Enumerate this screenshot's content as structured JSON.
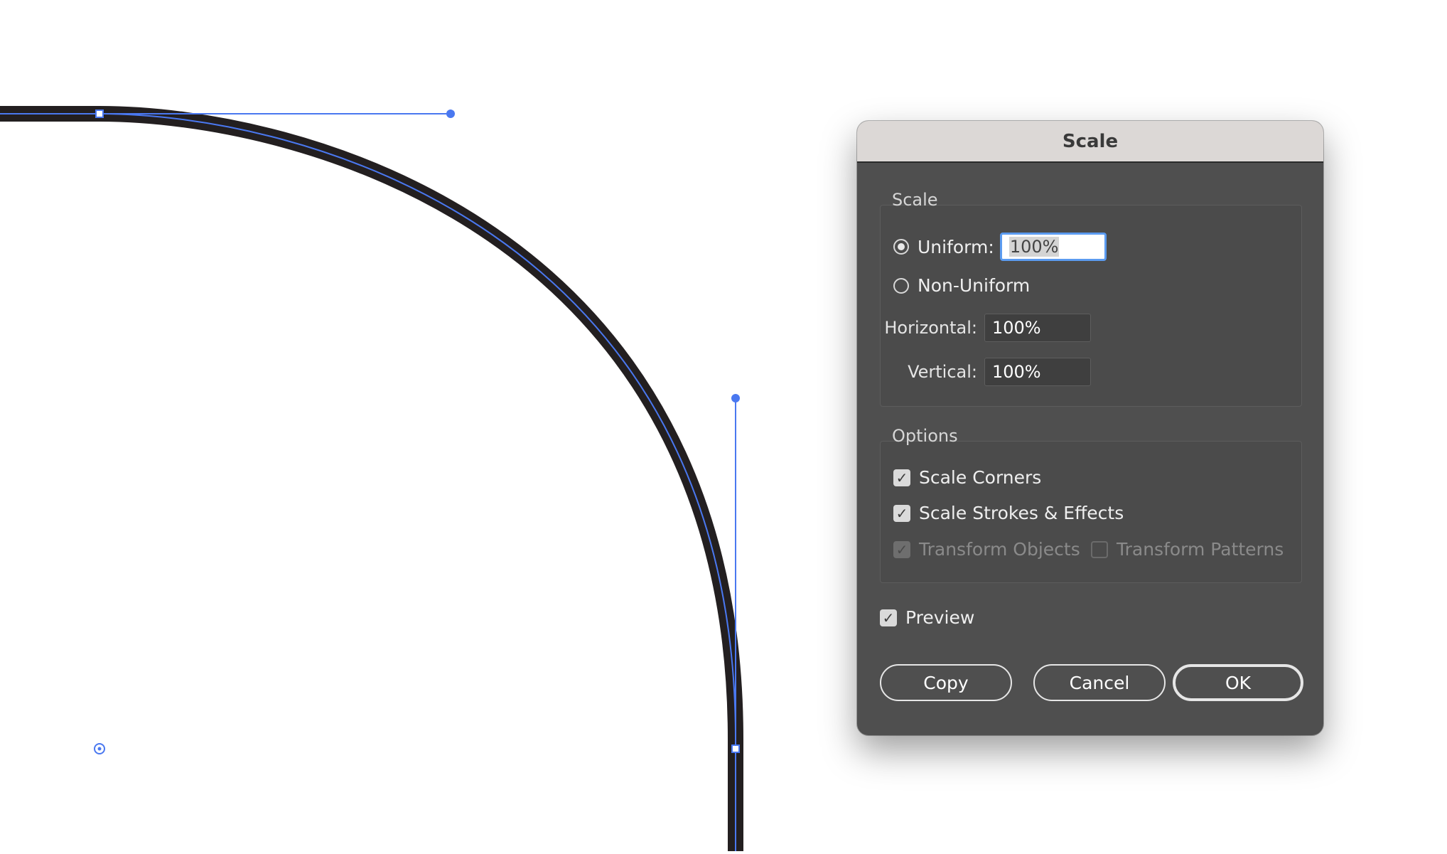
{
  "dialog": {
    "title": "Scale",
    "scale_group": {
      "legend": "Scale",
      "uniform_label": "Uniform:",
      "uniform_value": "100%",
      "uniform_selected": true,
      "non_uniform_label": "Non-Uniform",
      "non_uniform_selected": false,
      "horizontal_label": "Horizontal:",
      "horizontal_value": "100%",
      "vertical_label": "Vertical:",
      "vertical_value": "100%"
    },
    "options_group": {
      "legend": "Options",
      "scale_corners_label": "Scale Corners",
      "scale_corners_checked": true,
      "scale_strokes_label": "Scale Strokes & Effects",
      "scale_strokes_checked": true,
      "transform_objects_label": "Transform Objects",
      "transform_objects_checked": true,
      "transform_patterns_label": "Transform Patterns",
      "transform_patterns_checked": false
    },
    "preview_label": "Preview",
    "preview_checked": true,
    "buttons": {
      "copy": "Copy",
      "cancel": "Cancel",
      "ok": "OK"
    }
  },
  "colors": {
    "dialog_bg": "#4f4f4f",
    "titlebar_bg": "#dcd8d6",
    "path_stroke": "#231f20",
    "selection_blue": "#4a78f0",
    "focus_ring": "#5b9bf0"
  },
  "icons": {
    "check": "checkmark-icon",
    "radio_selected": "radio-selected-icon",
    "radio_unselected": "radio-unselected-icon",
    "anchor_point": "anchor-point-icon",
    "handle_point": "bezier-handle-icon",
    "reference_point": "reference-point-icon"
  }
}
